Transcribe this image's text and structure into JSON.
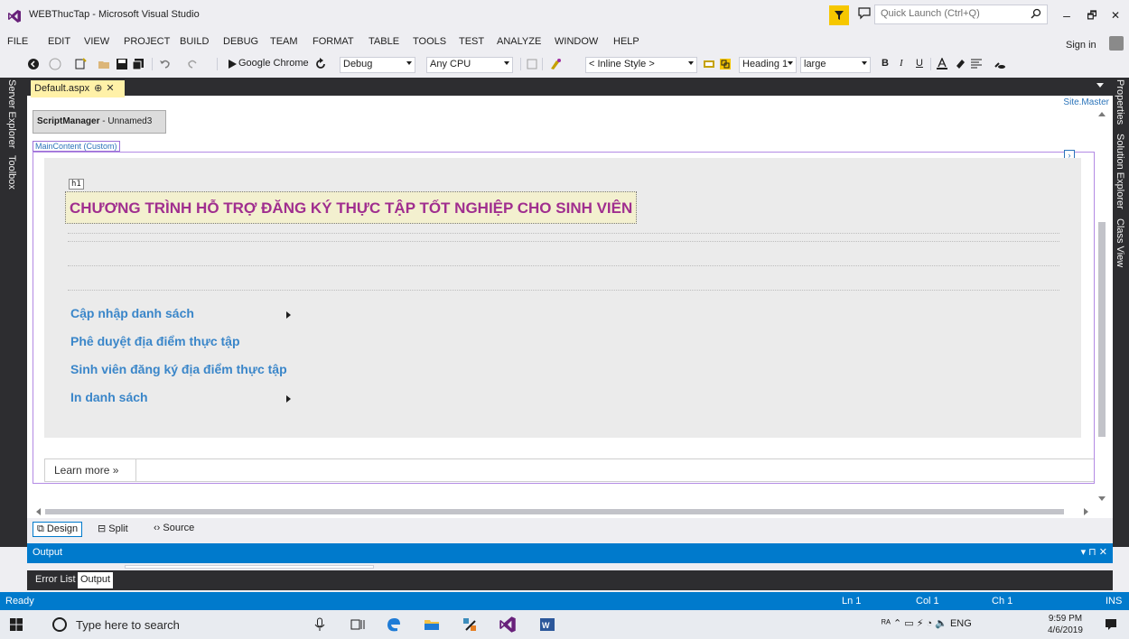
{
  "window": {
    "title": "WEBThucTap - Microsoft Visual Studio",
    "quick_launch_placeholder": "Quick Launch (Ctrl+Q)",
    "minimize_label": "–",
    "restore_label": "🗗",
    "close_label": "✕"
  },
  "menu": {
    "items": [
      "FILE",
      "EDIT",
      "VIEW",
      "PROJECT",
      "BUILD",
      "DEBUG",
      "TEAM",
      "FORMAT",
      "TABLE",
      "TOOLS",
      "TEST",
      "ANALYZE",
      "WINDOW",
      "HELP"
    ],
    "sign_in": "Sign in"
  },
  "toolbar": {
    "run_target": "Google Chrome",
    "configuration": "Debug",
    "platform": "Any CPU",
    "style_select": "< Inline Style >",
    "block_format": "Heading 1",
    "font_size": "large",
    "bold": "B",
    "italic": "I",
    "underline": "U"
  },
  "side_tabs": {
    "left": [
      "Server Explorer",
      "Toolbox"
    ],
    "right": [
      "Properties",
      "Solution Explorer",
      "Class View"
    ]
  },
  "document": {
    "tab_label": "Default.aspx",
    "tab_pin": "⊕",
    "tab_close": "✕",
    "master_label": "Site.Master",
    "script_manager_bold": "ScriptManager",
    "script_manager_rest": " - Unnamed3",
    "content_label": "MainContent (Custom)",
    "h1_tag": "h1",
    "heading": "CHƯƠNG TRÌNH HỖ TRỢ ĐĂNG KÝ THỰC TẬP TỐT NGHIỆP CHO SINH VIÊN",
    "nav_links": [
      "Cập nhập danh sách",
      "Phê duyệt địa điểm thực tập",
      "Sinh viên đăng ký địa điểm thực tập",
      "In danh sách"
    ],
    "learn_more": "Learn more »"
  },
  "view_switch": {
    "design": "⧉ Design",
    "split": "⊟ Split",
    "source": "‹› Source"
  },
  "output": {
    "title": "Output",
    "controls": "▾ ⊓ ✕",
    "tabs": [
      "Error List",
      "Output"
    ]
  },
  "status": {
    "ready": "Ready",
    "ln": "Ln 1",
    "col": "Col 1",
    "ch": "Ch 1",
    "mode": "INS"
  },
  "taskbar": {
    "search_placeholder": "Type here to search",
    "tray": "ᴿᴬ  ⌃  ▭  ⚡  ◔  🔈  ENG",
    "time": "9:59 PM",
    "date": "4/6/2019"
  },
  "colors": {
    "accent": "#007acc",
    "chrome_dark": "#2d2d30",
    "heading_text": "#a02e8f",
    "link": "#3a86c9",
    "tab_active": "#fff1a8"
  }
}
